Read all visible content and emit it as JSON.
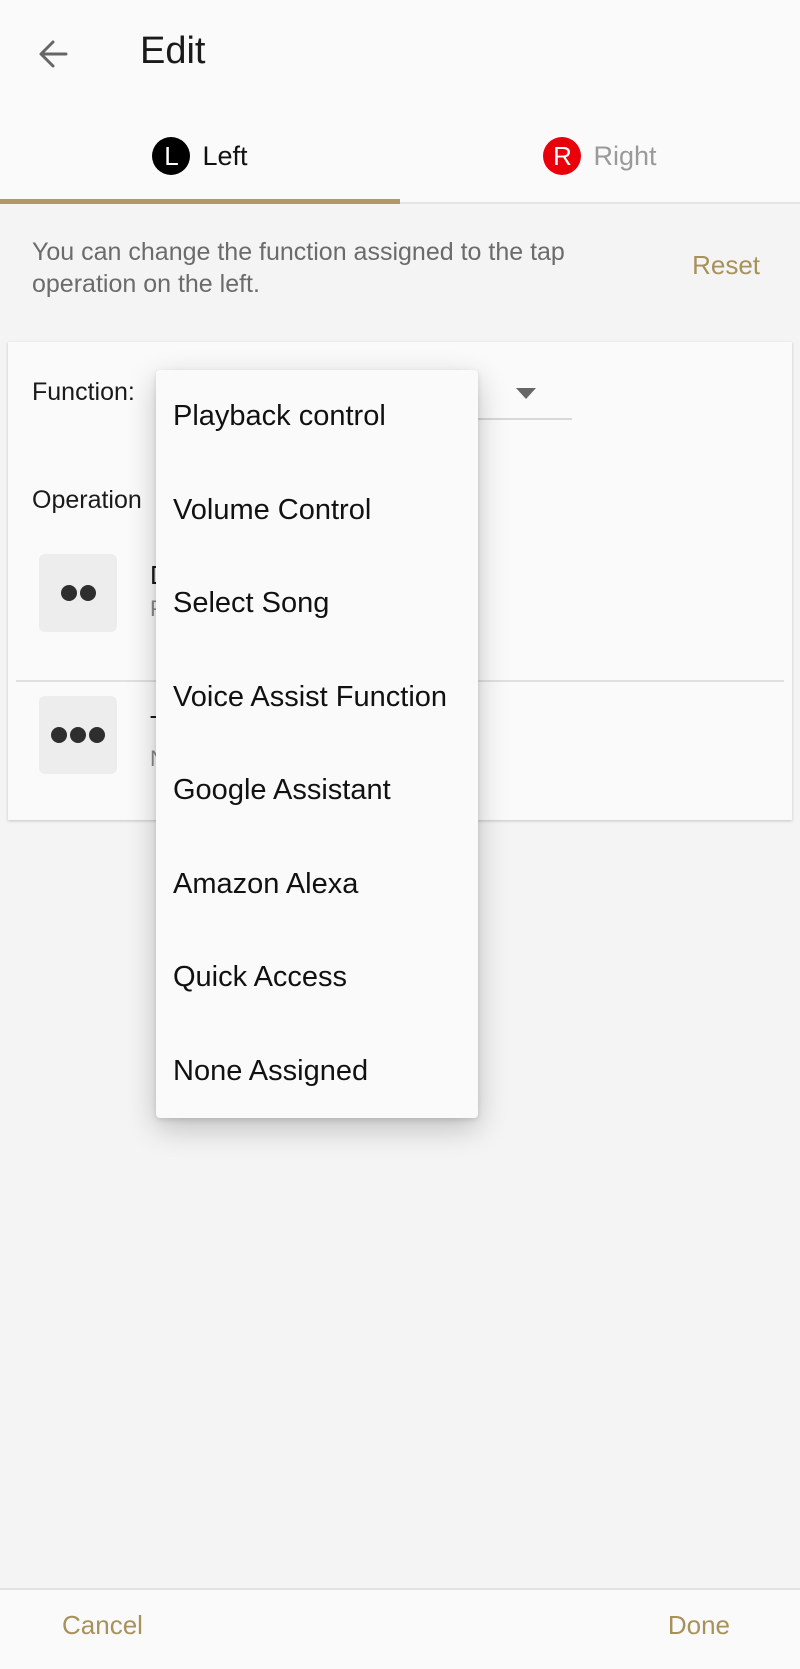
{
  "appbar": {
    "back_icon": "arrow-left-icon",
    "title": "Edit"
  },
  "tabs": [
    {
      "badge": "L",
      "label": "Left",
      "selected": true,
      "badge_color": "#000000"
    },
    {
      "badge": "R",
      "label": "Right",
      "selected": false,
      "badge_color": "#e8000b"
    }
  ],
  "accent_color": "#b09a63",
  "description": "You can change the function assigned to the tap operation on the left.",
  "reset_label": "Reset",
  "card": {
    "function_label": "Function:",
    "operation_label": "Operation",
    "operations": [
      {
        "icon": "double-tap-icon",
        "title_visible": "D",
        "subtitle_visible": "P"
      },
      {
        "icon": "triple-tap-icon",
        "title_visible": "T",
        "subtitle_visible": "N"
      }
    ]
  },
  "dropdown": {
    "options": [
      "Playback control",
      "Volume Control",
      "Select Song",
      "Voice Assist Function",
      "Google Assistant",
      "Amazon Alexa",
      "Quick Access",
      "None Assigned"
    ]
  },
  "bottombar": {
    "cancel_label": "Cancel",
    "done_label": "Done"
  }
}
